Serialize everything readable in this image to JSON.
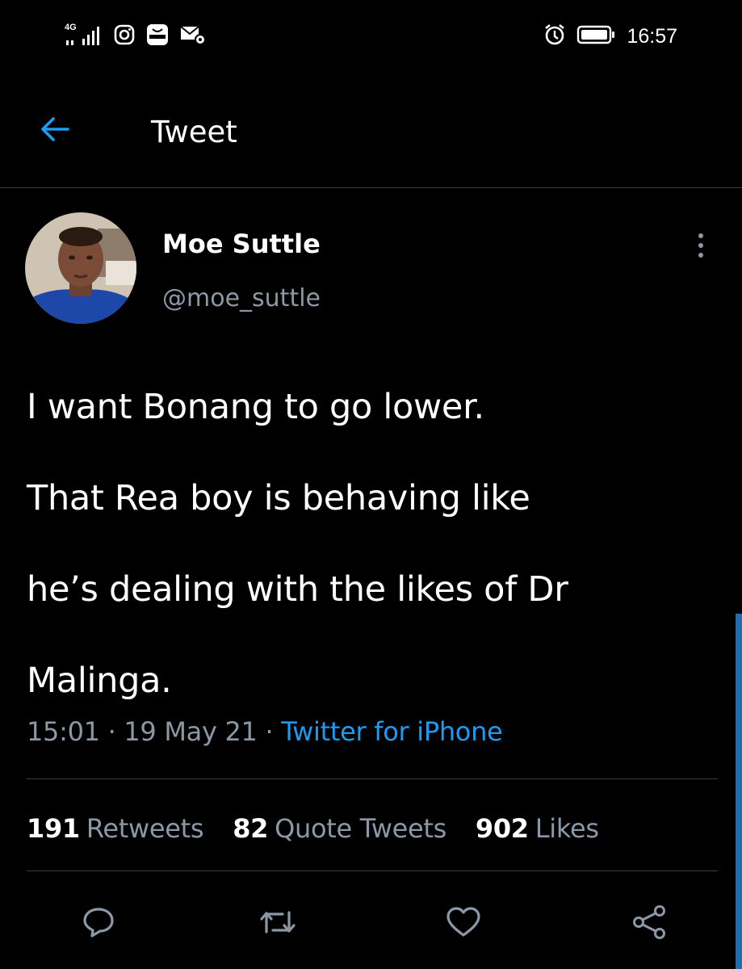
{
  "status_bar": {
    "network": "4G",
    "time": "16:57",
    "icons": [
      "signal-icon",
      "instagram-icon",
      "huawei-app-icon",
      "mail-settings-icon",
      "alarm-icon",
      "battery-icon"
    ]
  },
  "header": {
    "title": "Tweet",
    "back_icon": "arrow-left-icon"
  },
  "tweet": {
    "author_name": "Moe Suttle",
    "author_handle": "@moe_suttle",
    "text_lines": [
      "I want Bonang to go lower.",
      "That Rea boy is behaving like",
      "he’s dealing with the likes of Dr",
      "Malinga."
    ],
    "time": "15:01",
    "date": "19 May 21",
    "separator": "·",
    "source": "Twitter for iPhone"
  },
  "stats": {
    "retweets_count": "191",
    "retweets_label": "Retweets",
    "quotes_count": "82",
    "quotes_label": "Quote Tweets",
    "likes_count": "902",
    "likes_label": "Likes"
  },
  "actions": [
    "reply-icon",
    "retweet-icon",
    "like-icon",
    "share-icon"
  ],
  "colors": {
    "background": "#000000",
    "accent": "#1d9bf0",
    "secondary_text": "#8b98a5",
    "divider": "#3a3d40"
  }
}
